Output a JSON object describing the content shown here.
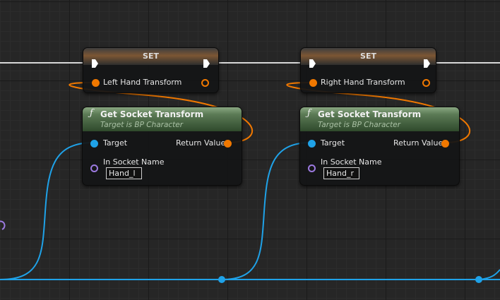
{
  "nodes": {
    "set_left": {
      "title": "SET",
      "variable_label": "Left Hand Transform"
    },
    "set_right": {
      "title": "SET",
      "variable_label": "Right Hand Transform"
    },
    "func_left": {
      "title": "Get Socket Transform",
      "subtitle": "Target is BP Character",
      "target_label": "Target",
      "return_label": "Return Value",
      "socket_label": "In Socket Name",
      "socket_value": "Hand_l",
      "icon": "function-icon"
    },
    "func_right": {
      "title": "Get Socket Transform",
      "subtitle": "Target is BP Character",
      "target_label": "Target",
      "return_label": "Return Value",
      "socket_label": "In Socket Name",
      "socket_value": "Hand_r",
      "icon": "function-icon"
    }
  },
  "colors": {
    "background": "#262626",
    "exec_wire": "#d8d8d8",
    "transform_pin": "#f07800",
    "object_pin": "#1fa2e8",
    "name_pin": "#9c7ae0",
    "function_header": "#5b7a55",
    "set_header": "#7c5634"
  }
}
